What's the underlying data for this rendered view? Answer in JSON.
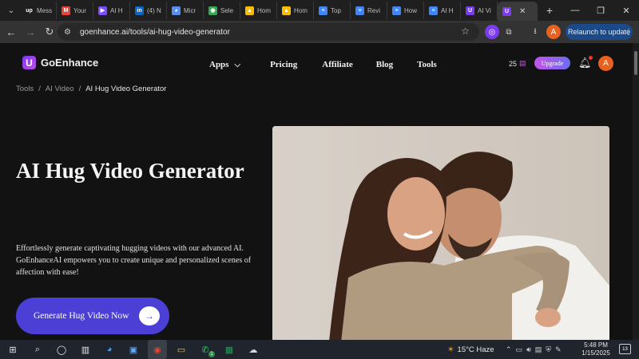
{
  "browser": {
    "tabs": [
      {
        "title": "Mess",
        "favicon": "upwork-icon",
        "color": "#1f1f1f",
        "glyph": "up"
      },
      {
        "title": "Your",
        "favicon": "gmail-icon",
        "color": "#ea4335",
        "glyph": "M"
      },
      {
        "title": "AI H",
        "favicon": "play-icon",
        "color": "#7c4dff",
        "glyph": "▶"
      },
      {
        "title": "(4) N",
        "favicon": "linkedin-icon",
        "color": "#0a66c2",
        "glyph": "in"
      },
      {
        "title": "Micr",
        "favicon": "copilot-icon",
        "color": "#5b8def",
        "glyph": "◕"
      },
      {
        "title": "Sele",
        "favicon": "chrome-web-icon",
        "color": "#34a853",
        "glyph": "◉"
      },
      {
        "title": "Hom",
        "favicon": "drive-icon",
        "color": "#fbbc04",
        "glyph": "▲"
      },
      {
        "title": "Hom",
        "favicon": "drive-icon",
        "color": "#fbbc04",
        "glyph": "▲"
      },
      {
        "title": "Top",
        "favicon": "docs-icon",
        "color": "#4285f4",
        "glyph": "≡"
      },
      {
        "title": "Revi",
        "favicon": "docs-icon",
        "color": "#4285f4",
        "glyph": "≡"
      },
      {
        "title": "How",
        "favicon": "docs-icon",
        "color": "#4285f4",
        "glyph": "≡"
      },
      {
        "title": "AI H",
        "favicon": "docs-icon",
        "color": "#4285f4",
        "glyph": "≡"
      },
      {
        "title": "AI Vi",
        "favicon": "goenhance-icon",
        "color": "#7b3cf0",
        "glyph": "U"
      },
      {
        "title": "",
        "favicon": "goenhance-icon",
        "color": "#7b3cf0",
        "glyph": "U",
        "active": true
      }
    ],
    "url": "goenhance.ai/tools/ai-hug-video-generator",
    "relaunch_label": "Relaunch to update",
    "profile_initial": "A"
  },
  "site": {
    "logo_text": "GoEnhance",
    "logo_glyph": "U",
    "menu": {
      "apps": "Apps",
      "pricing": "Pricing",
      "affiliate": "Affiliate",
      "blog": "Blog",
      "tools": "Tools"
    },
    "credits": "25",
    "upgrade_label": "Upgrade",
    "avatar_initial": "A"
  },
  "breadcrumb": {
    "tools": "Tools",
    "ai_video": "AI Video",
    "current": "AI Hug Video Generator",
    "separator": "/"
  },
  "hero": {
    "title": "AI Hug Video Generator",
    "description": "Effortlessly generate captivating hugging videos with our advanced AI. GoEnhanceAI empowers you to create unique and personalized scenes of affection with ease!",
    "cta_label": "Generate Hug Video Now"
  },
  "taskbar": {
    "weather": "15°C  Haze",
    "weather_badge": "1",
    "whatsapp_badge": "1",
    "time": "5:48 PM",
    "date": "1/15/2025",
    "notifications": "13"
  },
  "colors": {
    "page_bg": "#121212",
    "cta": "#4b3fd6",
    "upgrade_from": "#c454ea",
    "upgrade_to": "#6d6cf2",
    "avatar": "#e8611f"
  }
}
